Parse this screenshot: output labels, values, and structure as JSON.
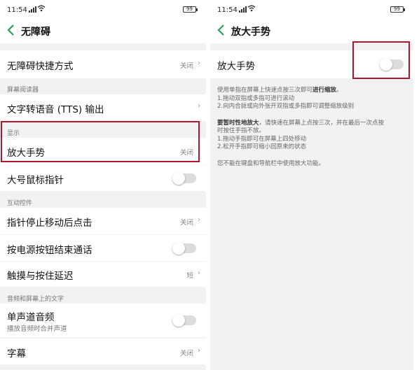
{
  "left": {
    "status": {
      "time": "11:54",
      "signal": "📶",
      "battery": "99"
    },
    "nav": {
      "title": "无障碍"
    },
    "rows": [
      {
        "label": "无障碍快捷方式",
        "value": "关闭"
      },
      {
        "section": "屏幕阅读器"
      },
      {
        "label": "文字转语音 (TTS) 输出"
      },
      {
        "section": "显示"
      },
      {
        "label": "放大手势",
        "value": "关闭"
      },
      {
        "label": "大号鼠标指针",
        "toggle": false
      },
      {
        "section": "互动控件"
      },
      {
        "label": "指针停止移动后点击",
        "value": "关闭"
      },
      {
        "label": "按电源按钮结束通话",
        "toggle": false
      },
      {
        "label": "触摸与按住延迟",
        "value": "短"
      },
      {
        "section": "音频和屏幕上的文字"
      },
      {
        "label": "单声道音频",
        "sub": "播放音频时合并声道",
        "toggle": false
      },
      {
        "label": "字幕",
        "value": "关闭"
      }
    ]
  },
  "right": {
    "status": {
      "time": "11:54",
      "battery": "99"
    },
    "nav": {
      "title": "放大手势"
    },
    "toggle_row": {
      "label": "放大手势",
      "toggle": false
    },
    "info": {
      "p1_line1_a": "使用单指在屏幕上快速点按三次即可",
      "p1_line1_b": "进行缩放",
      "p1_line1_c": "。",
      "p1_line2": "1.拖动双指或多指可进行滚动",
      "p1_line3": "2.向内合拢或向外张开双指或多指即可调整缩放级别",
      "p2_line1_a": "要暂时性地放大",
      "p2_line1_b": "，请快速在屏幕上点按三次，并在最后一次点按",
      "p2_line2": "时按住手指不放。",
      "p2_line3": "1.拖动手指即可在屏幕上四处移动",
      "p2_line4": "2.松开手指即可缩小回原来的状态",
      "p3": "您不能在键盘和导航栏中使用放大功能。"
    }
  },
  "colors": {
    "highlight": "#b3162a",
    "accent": "#2e9e5b",
    "toggle_off": "#dcdcdc"
  }
}
